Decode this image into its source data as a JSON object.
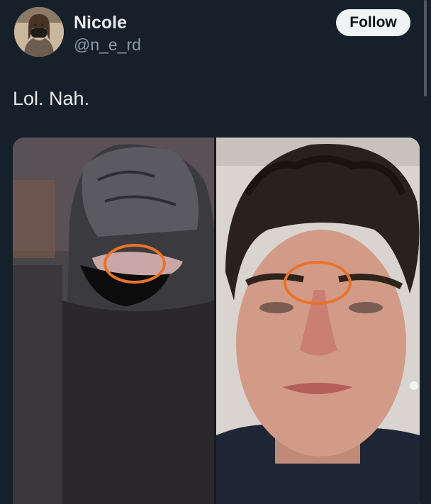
{
  "author": {
    "display_name": "Nicole",
    "handle": "@n_e_rd",
    "avatar_icon": "profile-photo"
  },
  "actions": {
    "follow_label": "Follow"
  },
  "tweet": {
    "text": "Lol. Nah."
  },
  "media": {
    "left_panel_icon": "masked-person-photo",
    "right_panel_icon": "man-selfie-photo",
    "annotation_color": "#e8732a"
  },
  "colors": {
    "background": "#15202b",
    "primary_text": "#e7e9ea",
    "secondary_text": "#8b98a5",
    "follow_bg": "#eff3f4"
  }
}
